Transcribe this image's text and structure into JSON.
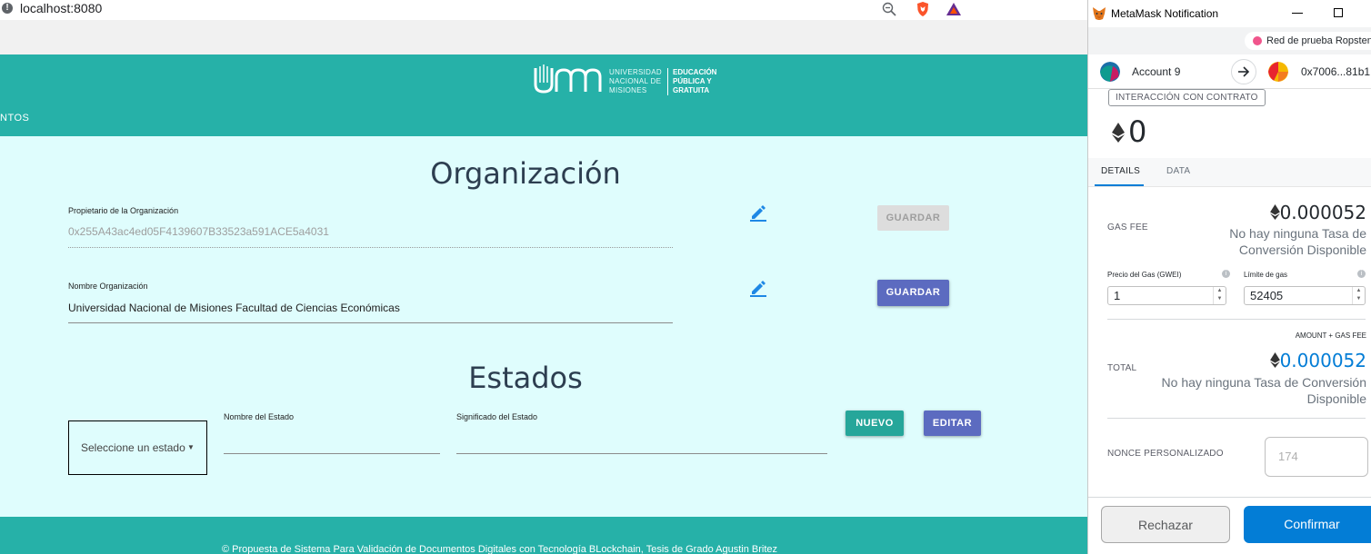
{
  "browser": {
    "url": "localhost:8080"
  },
  "header": {
    "logo_line1": "UNIVERSIDAD NACIONAL DE MISIONES",
    "logo_line2": "EDUCACIÓN PÚBLICA Y GRATUITA",
    "nav_fragment": "NTOS"
  },
  "organization": {
    "title": "Organización",
    "owner_label": "Propietario de la Organización",
    "owner_value": "0x255A43ac4ed05F4139607B33523a591ACE5a4031",
    "owner_save_label": "GUARDAR",
    "name_label": "Nombre Organización",
    "name_value": "Universidad Nacional de Misiones Facultad de Ciencias Económicas",
    "name_save_label": "GUARDAR"
  },
  "states": {
    "title": "Estados",
    "select_placeholder": "Seleccione un estado",
    "state_name_label": "Nombre del Estado",
    "state_meaning_label": "Significado del Estado",
    "new_label": "NUEVO",
    "edit_label": "EDITAR"
  },
  "footer": {
    "text": "© Propuesta de Sistema Para Validación de Documentos Digitales con Tecnología BLockchain, Tesis de Grado Agustin Britez"
  },
  "metamask": {
    "window_title": "MetaMask Notification",
    "network": "Red de prueba Ropsten",
    "from_account": "Account 9",
    "to_address": "0x7006...81b1",
    "action_pill": "INTERACCIÓN CON CONTRATO",
    "amount": "0",
    "tabs": [
      "DETAILS",
      "DATA"
    ],
    "active_tab": "DETAILS",
    "gas_fee_label": "GAS FEE",
    "gas_fee_value": "0.000052",
    "gas_fee_note": "No hay ninguna Tasa de Conversión Disponible",
    "gas_price_label": "Precio del Gas (GWEI)",
    "gas_price_value": "1",
    "gas_limit_label": "Límite de gas",
    "gas_limit_value": "52405",
    "amount_plus_gas_label": "AMOUNT + GAS FEE",
    "total_label": "TOTAL",
    "total_value": "0.000052",
    "total_note": "No hay ninguna Tasa de Conversión Disponible",
    "nonce_label": "NONCE PERSONALIZADO",
    "nonce_placeholder": "174",
    "reject_label": "Rechazar",
    "confirm_label": "Confirmar",
    "colors": {
      "accent_blue": "#037dd6",
      "network_dot": "#f0558c"
    }
  },
  "colors": {
    "header_teal": "#26b1a8",
    "main_bg": "#dffdfd",
    "btn_indigo": "#5c6bc0",
    "btn_teal": "#26a69a",
    "edit_icon_blue": "#1e88e5"
  }
}
